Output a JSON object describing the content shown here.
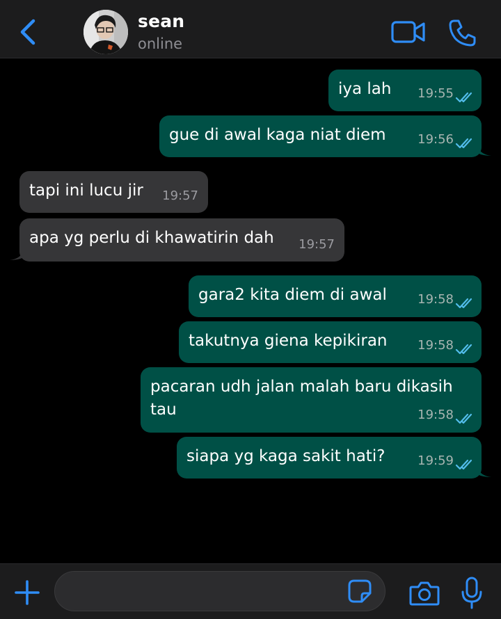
{
  "colors": {
    "accent": "#2f8df6",
    "outgoing_bubble": "#005046",
    "incoming_bubble": "#363638",
    "read_ticks": "#53bdeb",
    "background": "#000000",
    "bar": "#1c1c1d"
  },
  "header": {
    "back_icon": "chevron-left-icon",
    "contact_name": "sean",
    "status": "online",
    "video_icon": "video-camera-icon",
    "call_icon": "phone-icon"
  },
  "messages": [
    {
      "direction": "out",
      "text": "iya lah",
      "time": "19:55",
      "status": "read"
    },
    {
      "direction": "out",
      "text": "gue di awal kaga niat diem",
      "time": "19:56",
      "status": "read"
    },
    {
      "direction": "in",
      "text": "tapi ini lucu jir",
      "time": "19:57"
    },
    {
      "direction": "in",
      "text": "apa yg perlu di khawatirin dah",
      "time": "19:57"
    },
    {
      "direction": "out",
      "text": "gara2 kita diem di awal",
      "time": "19:58",
      "status": "read"
    },
    {
      "direction": "out",
      "text": "takutnya giena kepikiran",
      "time": "19:58",
      "status": "read"
    },
    {
      "direction": "out",
      "text": "pacaran udh jalan malah baru dikasih tau",
      "time": "19:58",
      "status": "read"
    },
    {
      "direction": "out",
      "text": "siapa yg kaga sakit hati?",
      "time": "19:59",
      "status": "read"
    }
  ],
  "composer": {
    "value": "",
    "plus_icon": "plus-icon",
    "sticker_icon": "sticker-icon",
    "camera_icon": "camera-icon",
    "mic_icon": "microphone-icon"
  }
}
